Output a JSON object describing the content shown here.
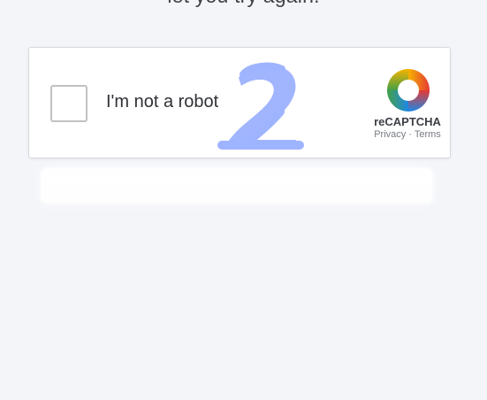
{
  "page": {
    "top_text": "let you try again."
  },
  "captcha": {
    "checkbox_label": "I'm not a robot",
    "brand": "reCAPTCHA",
    "privacy": "Privacy",
    "separator": " · ",
    "terms": "Terms",
    "scribble_color": "#9fb4ff",
    "logo_icon": "recaptcha-logo-icon"
  }
}
